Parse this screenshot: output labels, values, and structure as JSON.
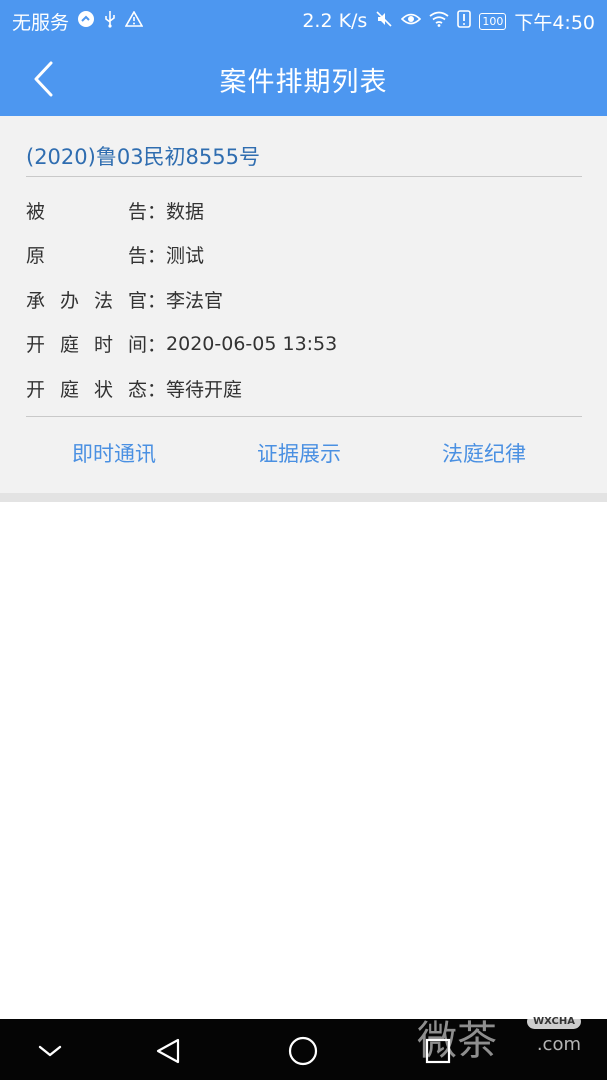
{
  "status_bar": {
    "carrier": "无服务",
    "speed": "2.2 K/s",
    "battery": "100",
    "time": "下午4:50"
  },
  "header": {
    "title": "案件排期列表"
  },
  "case": {
    "number": "(2020)鲁03民初8555号",
    "fields": [
      {
        "label_chars": [
          "被",
          "告"
        ],
        "value": "数据"
      },
      {
        "label_chars": [
          "原",
          "告"
        ],
        "value": "测试"
      },
      {
        "label_chars": [
          "承",
          "办",
          "法",
          "官"
        ],
        "value": "李法官"
      },
      {
        "label_chars": [
          "开",
          "庭",
          "时",
          "间"
        ],
        "value": "2020-06-05 13:53"
      },
      {
        "label_chars": [
          "开",
          "庭",
          "状",
          "态"
        ],
        "value": "等待开庭"
      }
    ],
    "colon": "：",
    "actions": [
      "即时通讯",
      "证据展示",
      "法庭纪律"
    ]
  },
  "watermark": {
    "text": "微茶",
    "badge": "WXCHA",
    "domain": ".com"
  },
  "icons": {
    "back": "chevron-left-icon",
    "nav_back": "triangle-back-icon",
    "nav_home": "circle-home-icon",
    "nav_recent": "square-recent-icon",
    "nav_down": "chevron-down-icon"
  },
  "colors": {
    "header_bg": "#4d97f0",
    "case_number": "#2f6db0",
    "action_link": "#4a90e2"
  }
}
